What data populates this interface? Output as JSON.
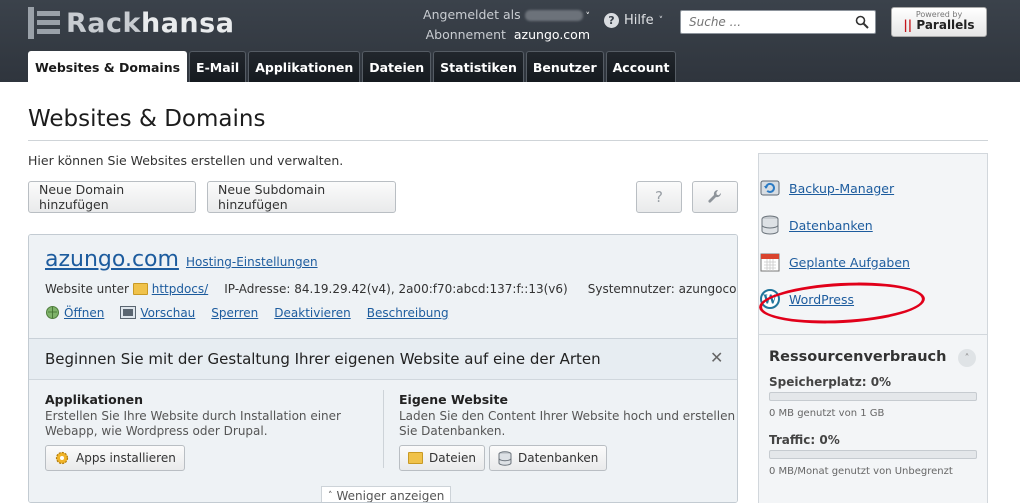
{
  "header": {
    "logo_text_a": "Rack",
    "logo_text_b": "hansa",
    "logged_in_label": "Angemeldet als",
    "subscription_label": "Abonnement",
    "subscription_value": "azungo.com",
    "help_label": "Hilfe",
    "search_placeholder": "Suche ...",
    "parallels_powered": "Powered by",
    "parallels_name": "Parallels"
  },
  "tabs": [
    {
      "label": "Websites & Domains",
      "active": true
    },
    {
      "label": "E-Mail"
    },
    {
      "label": "Applikationen"
    },
    {
      "label": "Dateien"
    },
    {
      "label": "Statistiken"
    },
    {
      "label": "Benutzer"
    },
    {
      "label": "Account"
    }
  ],
  "main": {
    "title": "Websites & Domains",
    "intro": "Hier können Sie Websites erstellen und verwalten.",
    "add_domain_btn": "Neue Domain hinzufügen",
    "add_subdomain_btn": "Neue Subdomain hinzufügen",
    "help_btn": "?"
  },
  "domain": {
    "name": "azungo.com",
    "hosting_link": "Hosting-Einstellungen",
    "website_label": "Website unter",
    "docroot": "httpdocs/",
    "ip_text": "IP-Adresse: 84.19.29.42(v4), 2a00:f70:abcd:137:f::13(v6)",
    "sysuser_text": "Systemnutzer: azungoco",
    "actions": [
      "Öffnen",
      "Vorschau",
      "Sperren",
      "Deaktivieren",
      "Beschreibung"
    ]
  },
  "start": {
    "title": "Beginnen Sie mit der Gestaltung Ihrer eigenen Website auf eine der Arten",
    "apps_title": "Applikationen",
    "apps_text_1": "Erstellen Sie Ihre Website durch Installation einer",
    "apps_text_2": "Webapp, wie Wordpress oder Drupal.",
    "apps_btn": "Apps installieren",
    "own_title": "Eigene Website",
    "own_text_1": "Laden Sie den Content Ihrer Website hoch und erstellen",
    "own_text_2": "Sie Datenbanken.",
    "files_btn": "Dateien",
    "db_btn": "Datenbanken",
    "less_label": "Weniger anzeigen"
  },
  "sidebar": {
    "links": [
      "Backup-Manager",
      "Datenbanken",
      "Geplante Aufgaben",
      "WordPress"
    ],
    "res_title": "Ressourcenverbrauch",
    "disk_label": "Speicherplatz: 0%",
    "disk_note": "0 MB genutzt von 1 GB",
    "traffic_label": "Traffic: 0%",
    "traffic_note": "0 MB/Monat genutzt von Unbegrenzt",
    "disk_fraction": 0,
    "traffic_fraction": 0
  }
}
